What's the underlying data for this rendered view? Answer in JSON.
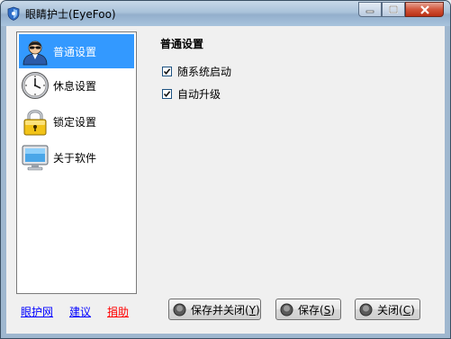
{
  "window": {
    "title": "眼睛护士(EyeFoo)"
  },
  "sidebar": {
    "items": [
      {
        "label": "普通设置",
        "icon": "user-avatar-icon",
        "active": true
      },
      {
        "label": "休息设置",
        "icon": "clock-icon",
        "active": false
      },
      {
        "label": "锁定设置",
        "icon": "padlock-icon",
        "active": false
      },
      {
        "label": "关于软件",
        "icon": "monitor-icon",
        "active": false
      }
    ]
  },
  "main": {
    "section_title": "普通设置",
    "options": [
      {
        "label": "随系统启动",
        "checked": true
      },
      {
        "label": "自动升级",
        "checked": true
      }
    ]
  },
  "footer": {
    "links": [
      {
        "label": "眼护网",
        "color": "#0000ff"
      },
      {
        "label": "建议",
        "color": "#0000ff"
      },
      {
        "label": "捐助",
        "color": "#ff0000"
      }
    ],
    "buttons": [
      {
        "label": "保存并关闭(",
        "key": "Y",
        "suffix": ")"
      },
      {
        "label": "保存(",
        "key": "S",
        "suffix": ")"
      },
      {
        "label": "关闭(",
        "key": "C",
        "suffix": ")"
      }
    ]
  },
  "colors": {
    "selection": "#3399ff",
    "link": "#0000ff",
    "donate_link": "#ff0000"
  }
}
